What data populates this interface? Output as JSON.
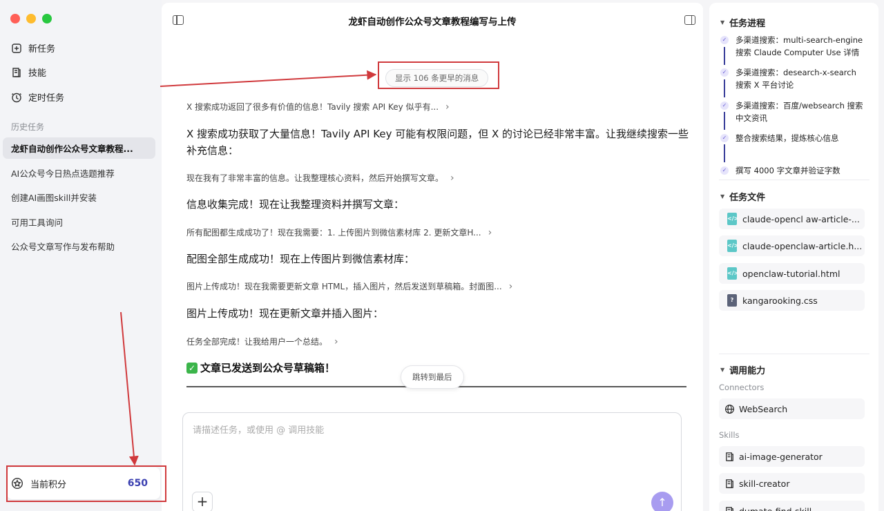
{
  "sidebar": {
    "nav": [
      {
        "label": "新任务",
        "icon": "new-task-icon"
      },
      {
        "label": "技能",
        "icon": "skills-icon"
      },
      {
        "label": "定时任务",
        "icon": "clock-icon"
      }
    ],
    "history_label": "历史任务",
    "history": [
      "龙虾自动创作公众号文章教程...",
      "AI公众号今日热点选题推荐",
      "创建AI画图skill并安装",
      "可用工具询问",
      "公众号文章写作与发布帮助"
    ],
    "points": {
      "label": "当前积分",
      "value": "650"
    }
  },
  "main": {
    "title": "龙虾自动创作公众号文章教程编写与上传",
    "earlier_button": "显示 106 条更早的消息",
    "messages": {
      "m1": "X 搜索成功返回了很多有价值的信息！Tavily 搜索 API Key 似乎有...",
      "m2": "X 搜索成功获取了大量信息！Tavily API Key 可能有权限问题，但 X 的讨论已经非常丰富。让我继续搜索一些补充信息：",
      "m3": "现在我有了非常丰富的信息。让我整理核心资料，然后开始撰写文章。",
      "m4": "信息收集完成！现在让我整理资料并撰写文章：",
      "m5": "所有配图都生成成功了！现在我需要：1. 上传图片到微信素材库 2. 更新文章H...",
      "m6": "配图全部生成成功！现在上传图片到微信素材库：",
      "m7": "图片上传成功！现在我需要更新文章 HTML，插入图片，然后发送到草稿箱。封面图...",
      "m8": "图片上传成功！现在更新文章并插入图片：",
      "m9": "任务全部完成！让我给用户一个总结。",
      "final": "文章已发送到公众号草稿箱！"
    },
    "jump_button": "跳转到最后",
    "composer_placeholder": "请描述任务，或使用 @ 调用技能",
    "plus_label": "+",
    "send_label": "↑"
  },
  "right": {
    "progress_header": "任务进程",
    "progress": [
      {
        "line1": "多渠道搜索：multi-search-engine",
        "line2": "搜索 Claude Computer Use 详情"
      },
      {
        "line1": "多渠道搜索：desearch-x-search",
        "line2": "搜索 X 平台讨论"
      },
      {
        "line1": "多渠道搜索：百度/websearch 搜索",
        "line2": "中文资讯"
      },
      {
        "line1": "整合搜索结果，提炼核心信息",
        "line2": ""
      },
      {
        "line1": "撰写 4000 字文章并验证字数",
        "line2": ""
      }
    ],
    "files_header": "任务文件",
    "files": [
      {
        "name": "claude-opencl aw-article-...",
        "type": "html"
      },
      {
        "name": "claude-openclaw-article.h...",
        "type": "html"
      },
      {
        "name": "openclaw-tutorial.html",
        "type": "html"
      },
      {
        "name": "kangarooking.css",
        "type": "css"
      }
    ],
    "capabilities_header": "调用能力",
    "connectors_label": "Connectors",
    "connectors": [
      "WebSearch"
    ],
    "skills_label": "Skills",
    "skills": [
      "ai-image-generator",
      "skill-creator",
      "dumate-find-skill"
    ]
  },
  "colors": {
    "accent": "#3a3fb0",
    "annotation": "#d0393c",
    "send": "#a89cf0"
  }
}
